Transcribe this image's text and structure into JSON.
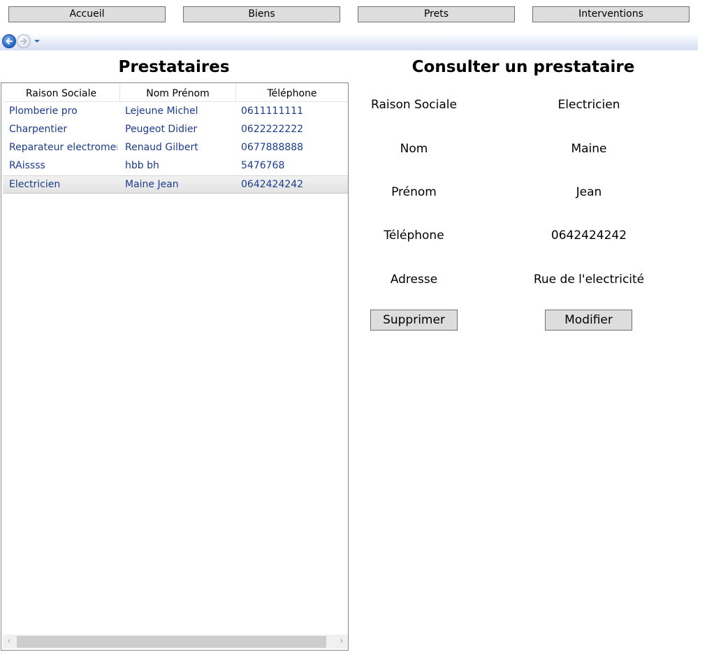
{
  "nav": {
    "buttons": [
      "Accueil",
      "Biens",
      "Prets",
      "Interventions"
    ]
  },
  "list_panel": {
    "title": "Prestataires",
    "columns": [
      "Raison Sociale",
      "Nom Prénom",
      "Téléphone"
    ],
    "rows": [
      {
        "raison": "Plomberie pro",
        "nom": "Lejeune Michel",
        "tel": "0611111111"
      },
      {
        "raison": "Charpentier",
        "nom": "Peugeot Didier",
        "tel": "0622222222"
      },
      {
        "raison": "Reparateur electromenager",
        "nom": "Renaud Gilbert",
        "tel": "0677888888"
      },
      {
        "raison": "RAissss",
        "nom": "hbb bh",
        "tel": "5476768"
      },
      {
        "raison": "Electricien",
        "nom": "Maine Jean",
        "tel": "0642424242"
      }
    ],
    "selected_row": 4,
    "scroll_left": "‹",
    "scroll_right": "›"
  },
  "detail_panel": {
    "title": "Consulter un prestataire",
    "fields": [
      {
        "label": "Raison Sociale",
        "value": "Electricien"
      },
      {
        "label": "Nom",
        "value": "Maine"
      },
      {
        "label": "Prénom",
        "value": "Jean"
      },
      {
        "label": "Téléphone",
        "value": "0642424242"
      },
      {
        "label": "Adresse",
        "value": "Rue de l'electricité"
      }
    ],
    "delete_label": "Supprimer",
    "edit_label": "Modifier"
  },
  "colors": {
    "button_bg": "#dddddd",
    "row_text": "#1a3c8a",
    "nav_back": "#2f6fcf"
  },
  "icons": {
    "back": "back-arrow-icon",
    "forward": "forward-arrow-icon",
    "history": "chevron-down-icon"
  }
}
